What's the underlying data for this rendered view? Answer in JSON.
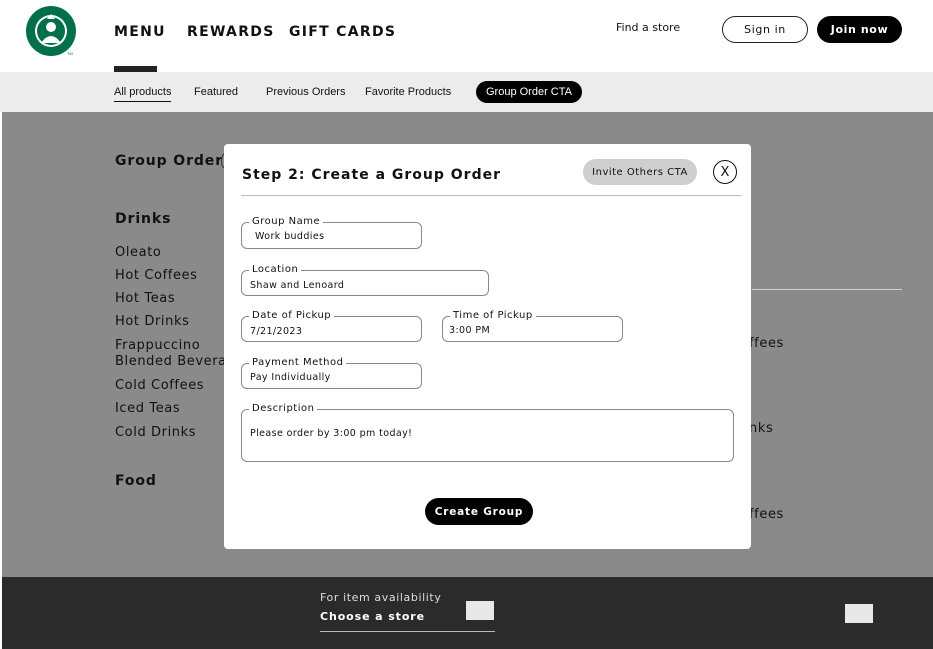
{
  "header": {
    "nav": [
      "MENU",
      "REWARDS",
      "GIFT CARDS"
    ],
    "find_store": "Find a store",
    "sign_in": "Sign in",
    "join_now": "Join now"
  },
  "subnav": {
    "tabs": [
      "All products",
      "Featured",
      "Previous Orders",
      "Favorite Products"
    ],
    "cta": "Group Order CTA"
  },
  "sidebar": {
    "group_order": "Group Order",
    "drinks_heading": "Drinks",
    "drinks": [
      "Oleato",
      "Hot Coffees",
      "Hot Teas",
      "Hot Drinks",
      "Frappuccino",
      "Blended Beverages",
      "Cold Coffees",
      "Iced Teas",
      "Cold Drinks"
    ],
    "food_heading": "Food"
  },
  "background_fragments": [
    "ffees",
    "nks",
    "ffees"
  ],
  "footer": {
    "availability": "For item availability",
    "choose_store": "Choose a store"
  },
  "modal": {
    "title": "Step 2: Create a Group Order",
    "invite_cta": "Invite Others CTA",
    "close": "X",
    "fields": {
      "group_name": {
        "label": "Group Name",
        "value": "Work buddies"
      },
      "location": {
        "label": "Location",
        "value": "Shaw and Lenoard"
      },
      "date": {
        "label": "Date of Pickup",
        "value": "7/21/2023"
      },
      "time": {
        "label": "Time of Pickup",
        "value": "3:00 PM"
      },
      "payment": {
        "label": "Payment Method",
        "value": "Pay Individually"
      },
      "description": {
        "label": "Description",
        "value": "Please order by 3:00 pm today!"
      }
    },
    "create_button": "Create Group"
  },
  "colors": {
    "brand_green": "#00704A",
    "overlay_gray": "#8a8a8a",
    "footer_dark": "#2b2b2b"
  }
}
